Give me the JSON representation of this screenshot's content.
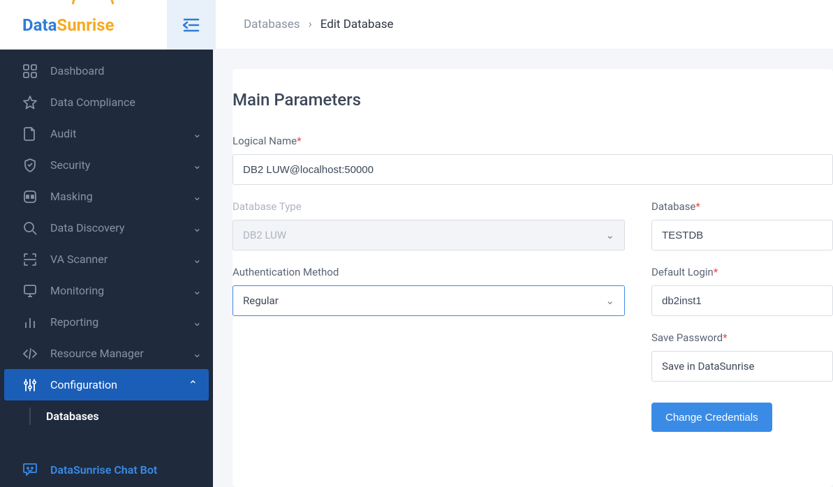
{
  "logo": {
    "part1": "Data",
    "part2": "S",
    "part3": "unrise"
  },
  "breadcrumb": {
    "parent": "Databases",
    "current": "Edit Database"
  },
  "sidebar": {
    "items": [
      {
        "label": "Dashboard",
        "icon": "dashboard",
        "expandable": false
      },
      {
        "label": "Data Compliance",
        "icon": "star",
        "expandable": false
      },
      {
        "label": "Audit",
        "icon": "document",
        "expandable": true
      },
      {
        "label": "Security",
        "icon": "shield",
        "expandable": true
      },
      {
        "label": "Masking",
        "icon": "mask",
        "expandable": true
      },
      {
        "label": "Data Discovery",
        "icon": "search",
        "expandable": true
      },
      {
        "label": "VA Scanner",
        "icon": "scanner",
        "expandable": true
      },
      {
        "label": "Monitoring",
        "icon": "monitor",
        "expandable": true
      },
      {
        "label": "Reporting",
        "icon": "chart",
        "expandable": true
      },
      {
        "label": "Resource Manager",
        "icon": "code",
        "expandable": true
      },
      {
        "label": "Configuration",
        "icon": "config",
        "expandable": true,
        "active": true
      }
    ],
    "subitem": "Databases",
    "chatbot": "DataSunrise Chat Bot"
  },
  "main": {
    "section_title": "Main Parameters",
    "logical_name_label": "Logical Name",
    "logical_name_value": "DB2 LUW@localhost:50000",
    "db_type_label": "Database Type",
    "db_type_value": "DB2 LUW",
    "database_label": "Database",
    "database_value": "TESTDB",
    "auth_label": "Authentication Method",
    "auth_value": "Regular",
    "login_label": "Default Login",
    "login_value": "db2inst1",
    "save_pw_label": "Save Password",
    "save_pw_value": "Save in DataSunrise",
    "change_creds_btn": "Change Credentials"
  }
}
